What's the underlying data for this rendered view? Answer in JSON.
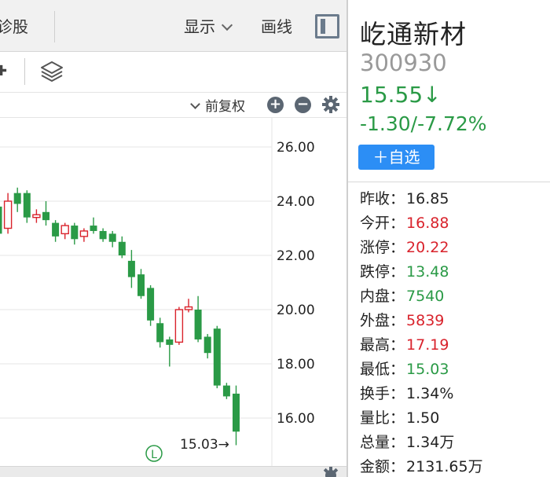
{
  "topbar": {
    "diag_tab": "诊股",
    "display_menu": "显示",
    "draw_menu": "画线"
  },
  "toolbar3": {
    "adjust_label": "前复权",
    "zoom_in": "+",
    "zoom_out": "−"
  },
  "chart": {
    "y_ticks": [
      "26.00",
      "24.00",
      "22.00",
      "20.00",
      "18.00",
      "16.00"
    ],
    "low_marker": "15.03→",
    "l_badge": "L",
    "up_color": "#d9232c",
    "down_color": "#2a9a46"
  },
  "chart_data": {
    "type": "candlestick",
    "ylim": [
      15,
      26.5
    ],
    "candles": [
      {
        "o": 23.8,
        "h": 24.2,
        "c": 22.8,
        "l": 22.5
      },
      {
        "o": 23.0,
        "h": 24.3,
        "c": 24.0,
        "l": 22.8
      },
      {
        "o": 24.3,
        "h": 24.5,
        "c": 23.9,
        "l": 23.6
      },
      {
        "o": 24.3,
        "h": 24.4,
        "c": 23.4,
        "l": 23.2
      },
      {
        "o": 23.4,
        "h": 23.7,
        "c": 23.5,
        "l": 23.2
      },
      {
        "o": 23.6,
        "h": 24.0,
        "c": 23.3,
        "l": 23.1
      },
      {
        "o": 23.2,
        "h": 23.3,
        "c": 22.7,
        "l": 22.5
      },
      {
        "o": 22.8,
        "h": 23.2,
        "c": 23.1,
        "l": 22.6
      },
      {
        "o": 23.1,
        "h": 23.2,
        "c": 22.6,
        "l": 22.4
      },
      {
        "o": 22.7,
        "h": 23.0,
        "c": 22.9,
        "l": 22.5
      },
      {
        "o": 23.1,
        "h": 23.4,
        "c": 22.9,
        "l": 22.8
      },
      {
        "o": 22.9,
        "h": 23.0,
        "c": 22.6,
        "l": 22.5
      },
      {
        "o": 22.8,
        "h": 22.9,
        "c": 22.5,
        "l": 22.3
      },
      {
        "o": 22.5,
        "h": 22.7,
        "c": 22.0,
        "l": 21.9
      },
      {
        "o": 21.8,
        "h": 22.2,
        "c": 21.2,
        "l": 20.8
      },
      {
        "o": 21.3,
        "h": 21.5,
        "c": 20.5,
        "l": 20.4
      },
      {
        "o": 20.8,
        "h": 20.9,
        "c": 19.6,
        "l": 19.4
      },
      {
        "o": 19.5,
        "h": 19.7,
        "c": 18.8,
        "l": 18.6
      },
      {
        "o": 18.9,
        "h": 19.0,
        "c": 18.7,
        "l": 17.9
      },
      {
        "o": 18.8,
        "h": 20.1,
        "c": 20.0,
        "l": 18.7
      },
      {
        "o": 20.0,
        "h": 20.4,
        "c": 20.1,
        "l": 19.9
      },
      {
        "o": 20.0,
        "h": 20.5,
        "c": 18.9,
        "l": 18.8
      },
      {
        "o": 19.0,
        "h": 19.1,
        "c": 18.4,
        "l": 18.2
      },
      {
        "o": 19.3,
        "h": 19.4,
        "c": 17.2,
        "l": 17.1
      },
      {
        "o": 17.2,
        "h": 17.3,
        "c": 16.8,
        "l": 16.7
      },
      {
        "o": 16.9,
        "h": 17.2,
        "c": 15.5,
        "l": 15.0
      }
    ]
  },
  "quote": {
    "name": "屹通新材",
    "code": "300930",
    "price": "15.55↓",
    "change": "-1.30/-7.72%",
    "watch_button": "＋自选"
  },
  "stats": [
    {
      "label": "昨收：",
      "value": "16.85",
      "color": "dark"
    },
    {
      "label": "今开：",
      "value": "16.88",
      "color": "red"
    },
    {
      "label": "涨停：",
      "value": "20.22",
      "color": "red"
    },
    {
      "label": "跌停：",
      "value": "13.48",
      "color": "green"
    },
    {
      "label": "内盘：",
      "value": "7540",
      "color": "green"
    },
    {
      "label": "外盘：",
      "value": "5839",
      "color": "red"
    },
    {
      "label": "最高：",
      "value": "17.19",
      "color": "red"
    },
    {
      "label": "最低：",
      "value": "15.03",
      "color": "green"
    },
    {
      "label": "换手：",
      "value": "1.34%",
      "color": "dark"
    },
    {
      "label": "量比：",
      "value": "1.50",
      "color": "dark"
    },
    {
      "label": "总量：",
      "value": "1.34万",
      "color": "dark"
    },
    {
      "label": "金额：",
      "value": "2131.65万",
      "color": "dark"
    }
  ]
}
